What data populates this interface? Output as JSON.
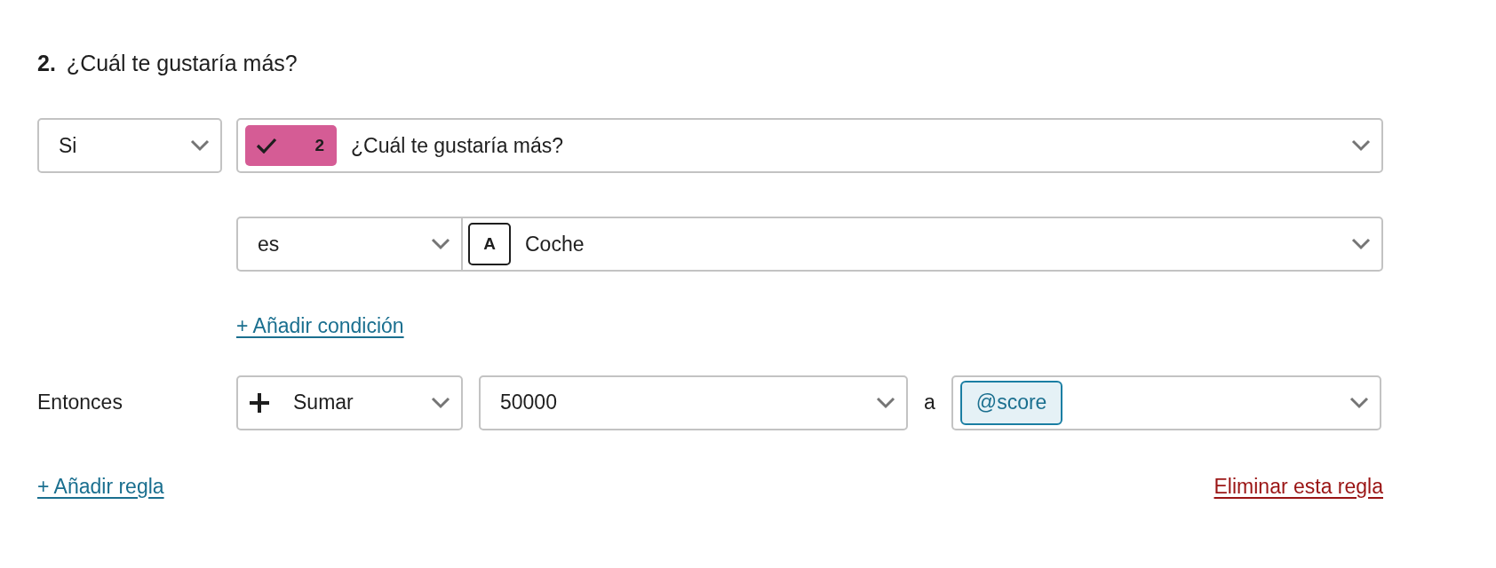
{
  "question": {
    "number": "2.",
    "text": "¿Cuál te gustaría más?"
  },
  "condition": {
    "connector": "Si",
    "badge_number": "2",
    "question": "¿Cuál te gustaría más?",
    "operator": "es",
    "answer_letter": "A",
    "answer": "Coche"
  },
  "add_condition": "+ Añadir condición",
  "action": {
    "label": "Entonces",
    "operation": "Sumar",
    "amount": "50000",
    "joiner": "a",
    "variable": "@score"
  },
  "add_rule": "+ Añadir regla",
  "delete_rule": "Eliminar esta regla"
}
